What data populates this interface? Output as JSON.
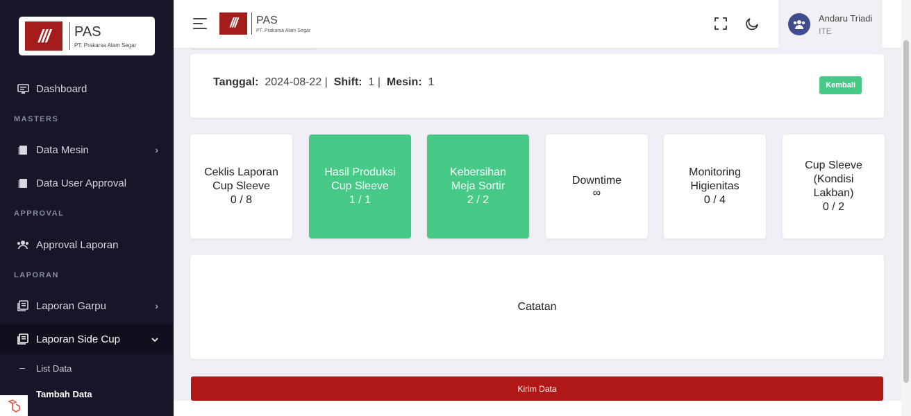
{
  "brand": {
    "mark": "///",
    "title": "PAS",
    "subtitle": "PT. Prakarsa Alam Segar"
  },
  "sidebar": {
    "dashboard": "Dashboard",
    "section_masters": "MASTERS",
    "data_mesin": "Data Mesin",
    "data_user_approval": "Data User Approval",
    "section_approval": "APPROVAL",
    "approval_laporan": "Approval Laporan",
    "section_laporan": "LAPORAN",
    "laporan_garpu": "Laporan Garpu",
    "laporan_side_cup": "Laporan Side Cup",
    "list_data": "List Data",
    "tambah_data": "Tambah Data"
  },
  "user": {
    "name": "Andaru Triadi",
    "role": "ITE"
  },
  "info": {
    "tanggal_label": "Tanggal:",
    "tanggal_value": "2024-08-22 |",
    "shift_label": "Shift:",
    "shift_value": "1 |",
    "mesin_label": "Mesin:",
    "mesin_value": "1",
    "kembali": "Kembali"
  },
  "tiles": [
    {
      "line1": "Ceklis Laporan",
      "line2": "Cup Sleeve",
      "count": "0 / 8",
      "status": "incomplete"
    },
    {
      "line1": "Hasil Produksi",
      "line2": "Cup Sleeve",
      "count": "1 / 1",
      "status": "complete"
    },
    {
      "line1": "Kebersihan",
      "line2": "Meja Sortir",
      "count": "2 / 2",
      "status": "complete"
    },
    {
      "line1": "Downtime",
      "line2": "",
      "count": "∞",
      "status": "incomplete"
    },
    {
      "line1": "Monitoring",
      "line2": "Higienitas",
      "count": "0 / 4",
      "status": "incomplete"
    },
    {
      "line1": "Cup Sleeve",
      "line2": "(Kondisi Lakban)",
      "count": "0 / 2",
      "status": "incomplete"
    }
  ],
  "catatan": "Catatan",
  "kirim": "Kirim Data",
  "colors": {
    "sidebar_bg": "#161628",
    "accent_green": "#47c987",
    "brand_red": "#b01717"
  }
}
